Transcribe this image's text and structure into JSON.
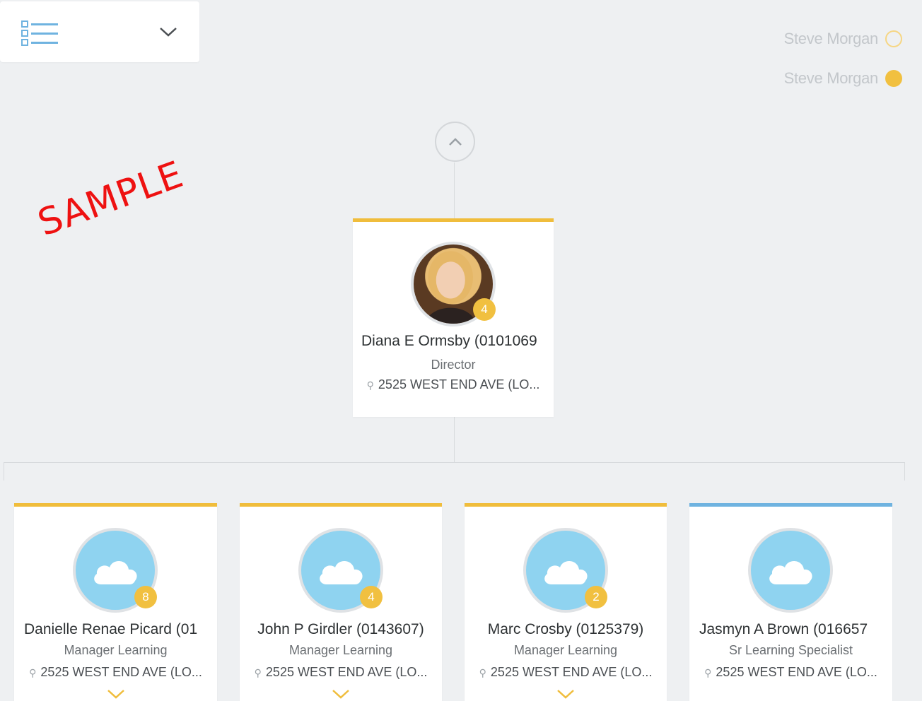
{
  "view_switcher": {
    "icon": "list-view-icon",
    "dropdown_icon": "chevron-down-icon"
  },
  "legend": [
    {
      "label": "Steve Morgan",
      "dot": "outline",
      "color": "#f6d683"
    },
    {
      "label": "Steve Morgan",
      "dot": "filled",
      "color": "#f1c040"
    }
  ],
  "watermark": "SAMPLE",
  "root": {
    "name": "Diana E Ormsby (0101069",
    "title": "Director",
    "location": "2525 WEST END AVE (LO...",
    "reports": "4",
    "accent": "#f0bd3c"
  },
  "children": [
    {
      "name": "Danielle Renae Picard (01",
      "title": "Manager Learning",
      "location": "2525 WEST END AVE (LO...",
      "reports": "8",
      "accent": "#f0bd3c"
    },
    {
      "name": "John P Girdler (0143607)",
      "title": "Manager Learning",
      "location": "2525 WEST END AVE (LO...",
      "reports": "4",
      "accent": "#f0bd3c"
    },
    {
      "name": "Marc Crosby (0125379)",
      "title": "Manager Learning",
      "location": "2525 WEST END AVE (LO...",
      "reports": "2",
      "accent": "#f0bd3c"
    },
    {
      "name": "Jasmyn A Brown (016657",
      "title": "Sr Learning Specialist",
      "location": "2525 WEST END AVE (LO...",
      "reports": "",
      "accent": "#6fb3e0"
    }
  ]
}
